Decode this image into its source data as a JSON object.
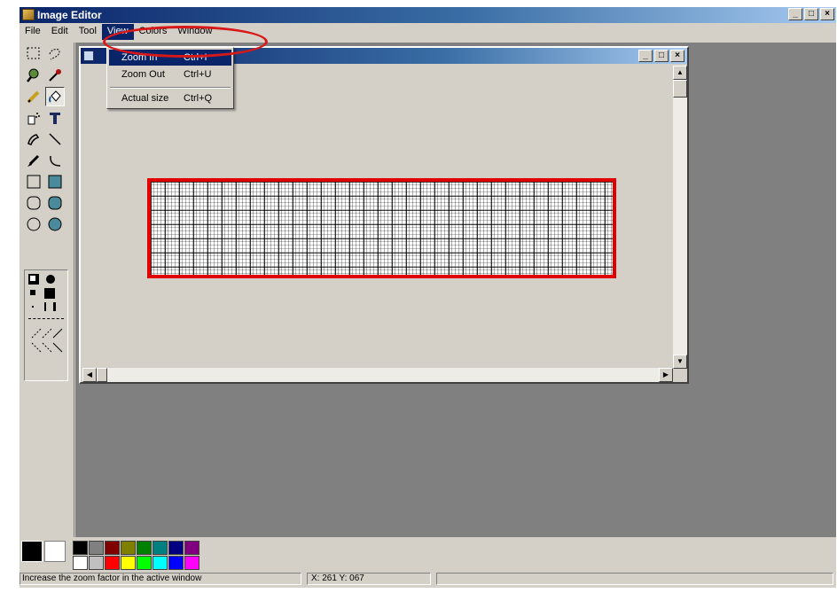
{
  "window": {
    "title": "Image Editor",
    "minimize_icon": "minimize-icon",
    "maximize_icon": "maximize-icon",
    "close_icon": "close-icon"
  },
  "menubar": {
    "items": [
      "File",
      "Edit",
      "Tool",
      "View",
      "Colors",
      "Window"
    ],
    "open_item": "View"
  },
  "view_menu": {
    "items": [
      {
        "label": "Zoom In",
        "shortcut": "Ctrl+I",
        "highlighted": true
      },
      {
        "label": "Zoom Out",
        "shortcut": "Ctrl+U",
        "highlighted": false
      },
      {
        "label": "Actual size",
        "shortcut": "Ctrl+Q",
        "highlighted": false
      }
    ]
  },
  "toolbox": {
    "tools": [
      "marquee-select-icon",
      "lasso-select-icon",
      "magnifier-icon",
      "eyedropper-icon",
      "pencil-icon",
      "paint-bucket-icon",
      "airbrush-icon",
      "text-tool-icon",
      "pen-icon",
      "line-icon",
      "brush-icon",
      "curve-icon",
      "hollow-rectangle-icon",
      "filled-rectangle-icon",
      "hollow-rounded-rect-icon",
      "filled-rounded-rect-icon",
      "hollow-ellipse-icon",
      "filled-ellipse-icon"
    ],
    "pressed_tool": "paint-bucket-icon"
  },
  "palette": {
    "foreground": "#000000",
    "background": "#ffffff",
    "colors": [
      "#000000",
      "#808080",
      "#800000",
      "#808000",
      "#008000",
      "#008080",
      "#000080",
      "#800080",
      "#ffffff",
      "#c0c0c0",
      "#ff0000",
      "#ffff00",
      "#00ff00",
      "#00ffff",
      "#0000ff",
      "#ff00ff"
    ]
  },
  "colors": {
    "title_active": "#0a246a",
    "highlight_box": "#e00000",
    "callout": "#d81818",
    "workspace": "#808080"
  },
  "statusbar": {
    "message": "Increase the zoom factor in the active window",
    "position": "X: 261  Y: 067"
  }
}
